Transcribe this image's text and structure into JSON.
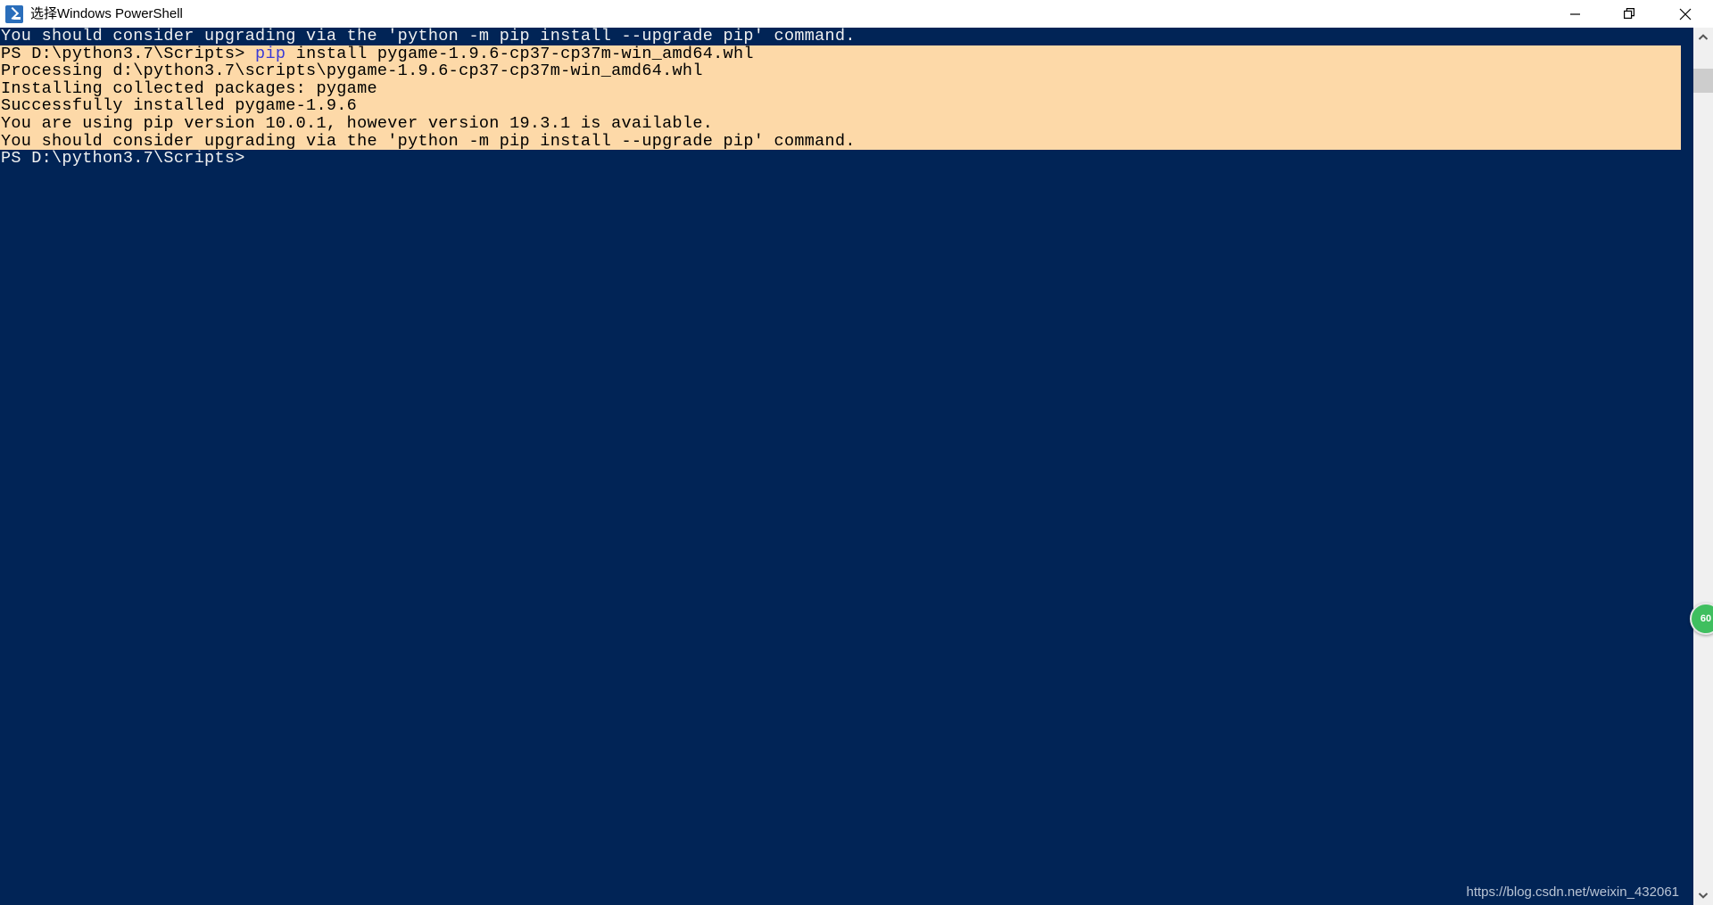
{
  "window": {
    "title": "选择Windows PowerShell",
    "icon": "powershell-icon",
    "background_color": "#012456",
    "titlebar_color": "#ffffff",
    "selection_color": "#fdd9a8",
    "text_color": "#f2f2f2",
    "accent_color": "#3b3bd6"
  },
  "controls": {
    "minimize_label": "Minimize",
    "restore_label": "Restore",
    "close_label": "Close"
  },
  "console": {
    "lines": [
      {
        "id": "line-0",
        "selected": false,
        "segments": [
          {
            "text": "You should consider upgrading via the 'python -m pip install --upgrade pip' command.",
            "style": "normal"
          }
        ]
      },
      {
        "id": "line-1",
        "selected": true,
        "segments": [
          {
            "text": "PS D:\\python3.7\\Scripts> ",
            "style": "normal"
          },
          {
            "text": "pip",
            "style": "accent"
          },
          {
            "text": " install pygame-1.9.6-cp37-cp37m-win_amd64.whl",
            "style": "normal"
          }
        ]
      },
      {
        "id": "line-2",
        "selected": true,
        "segments": [
          {
            "text": "Processing d:\\python3.7\\scripts\\pygame-1.9.6-cp37-cp37m-win_amd64.whl",
            "style": "normal"
          }
        ]
      },
      {
        "id": "line-3",
        "selected": true,
        "segments": [
          {
            "text": "Installing collected packages: pygame",
            "style": "normal"
          }
        ]
      },
      {
        "id": "line-4",
        "selected": true,
        "segments": [
          {
            "text": "Successfully installed pygame-1.9.6",
            "style": "normal"
          }
        ]
      },
      {
        "id": "line-5",
        "selected": true,
        "segments": [
          {
            "text": "You are using pip version 10.0.1, however version 19.3.1 is available.",
            "style": "normal"
          }
        ]
      },
      {
        "id": "line-6",
        "selected": true,
        "segments": [
          {
            "text": "You should consider upgrading via the 'python -m pip install --upgrade pip' command.",
            "style": "normal"
          }
        ]
      },
      {
        "id": "line-7",
        "selected": false,
        "segments": [
          {
            "text": "PS D:\\python3.7\\Scripts>",
            "style": "normal"
          }
        ]
      }
    ]
  },
  "scrollbar": {
    "up_label": "Scroll up",
    "down_label": "Scroll down",
    "thumb_label": "Scroll thumb"
  },
  "badge": {
    "text": "60"
  },
  "watermark": {
    "text": "https://blog.csdn.net/weixin_432061"
  }
}
